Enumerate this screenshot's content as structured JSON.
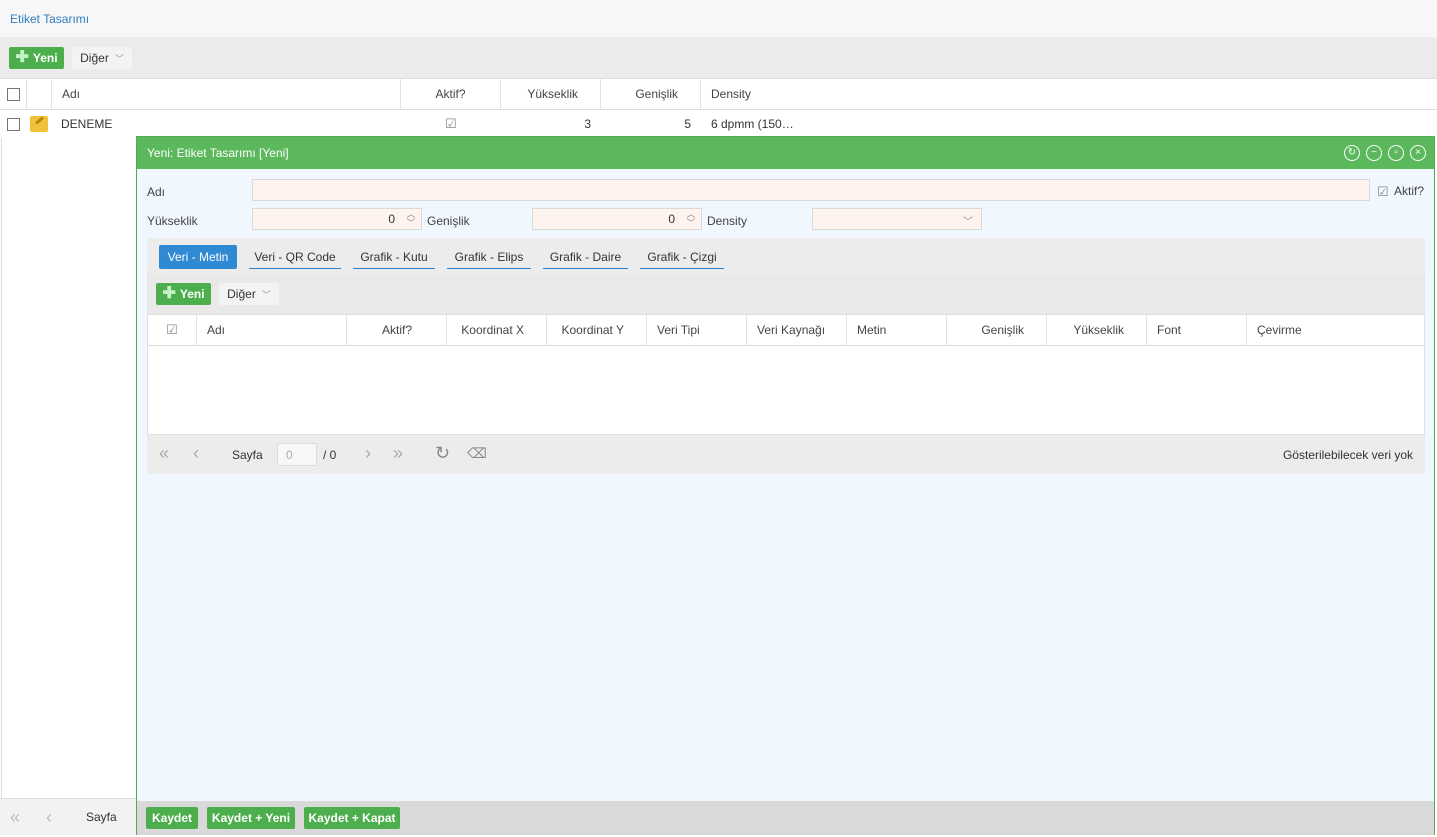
{
  "page": {
    "title": "Etiket Tasarımı",
    "toolbar": {
      "new_label": "Yeni",
      "other_label": "Diğer"
    },
    "grid": {
      "columns": [
        "Adı",
        "Aktif?",
        "Yükseklik",
        "Genişlik",
        "Density"
      ],
      "rows": [
        {
          "name": "DENEME",
          "active": true,
          "height": "3",
          "width": "5",
          "density": "6 dpmm (150…"
        }
      ]
    },
    "pager": {
      "page_label": "Sayfa"
    }
  },
  "modal": {
    "title": "Yeni: Etiket Tasarımı [Yeni]",
    "form": {
      "name_label": "Adı",
      "name_value": "",
      "active_label": "Aktif?",
      "active_checked": true,
      "height_label": "Yükseklik",
      "height_value": "0",
      "width_label": "Genişlik",
      "width_value": "0",
      "density_label": "Density",
      "density_value": ""
    },
    "tabs": [
      {
        "label": "Veri - Metin",
        "active": true
      },
      {
        "label": "Veri - QR Code",
        "active": false
      },
      {
        "label": "Grafik - Kutu",
        "active": false
      },
      {
        "label": "Grafik - Elips",
        "active": false
      },
      {
        "label": "Grafik - Daire",
        "active": false
      },
      {
        "label": "Grafik - Çizgi",
        "active": false
      }
    ],
    "sub_toolbar": {
      "new_label": "Yeni",
      "other_label": "Diğer"
    },
    "sub_grid": {
      "columns": [
        "Adı",
        "Aktif?",
        "Koordinat X",
        "Koordinat Y",
        "Veri Tipi",
        "Veri Kaynağı",
        "Metin",
        "Genişlik",
        "Yükseklik",
        "Font",
        "Çevirme"
      ]
    },
    "sub_pager": {
      "page_label": "Sayfa",
      "page_value": "0",
      "total": "/ 0",
      "empty_text": "Gösterilebilecek veri yok"
    },
    "footer": {
      "save_label": "Kaydet",
      "save_new_label": "Kaydet + Yeni",
      "save_close_label": "Kaydet + Kapat"
    }
  },
  "colors": {
    "accent_green": "#5cb85c",
    "button_green": "#4cae4c",
    "link_blue": "#2f7fc1",
    "active_tab_blue": "#2f89d3",
    "required_field": "#fff3ef"
  }
}
